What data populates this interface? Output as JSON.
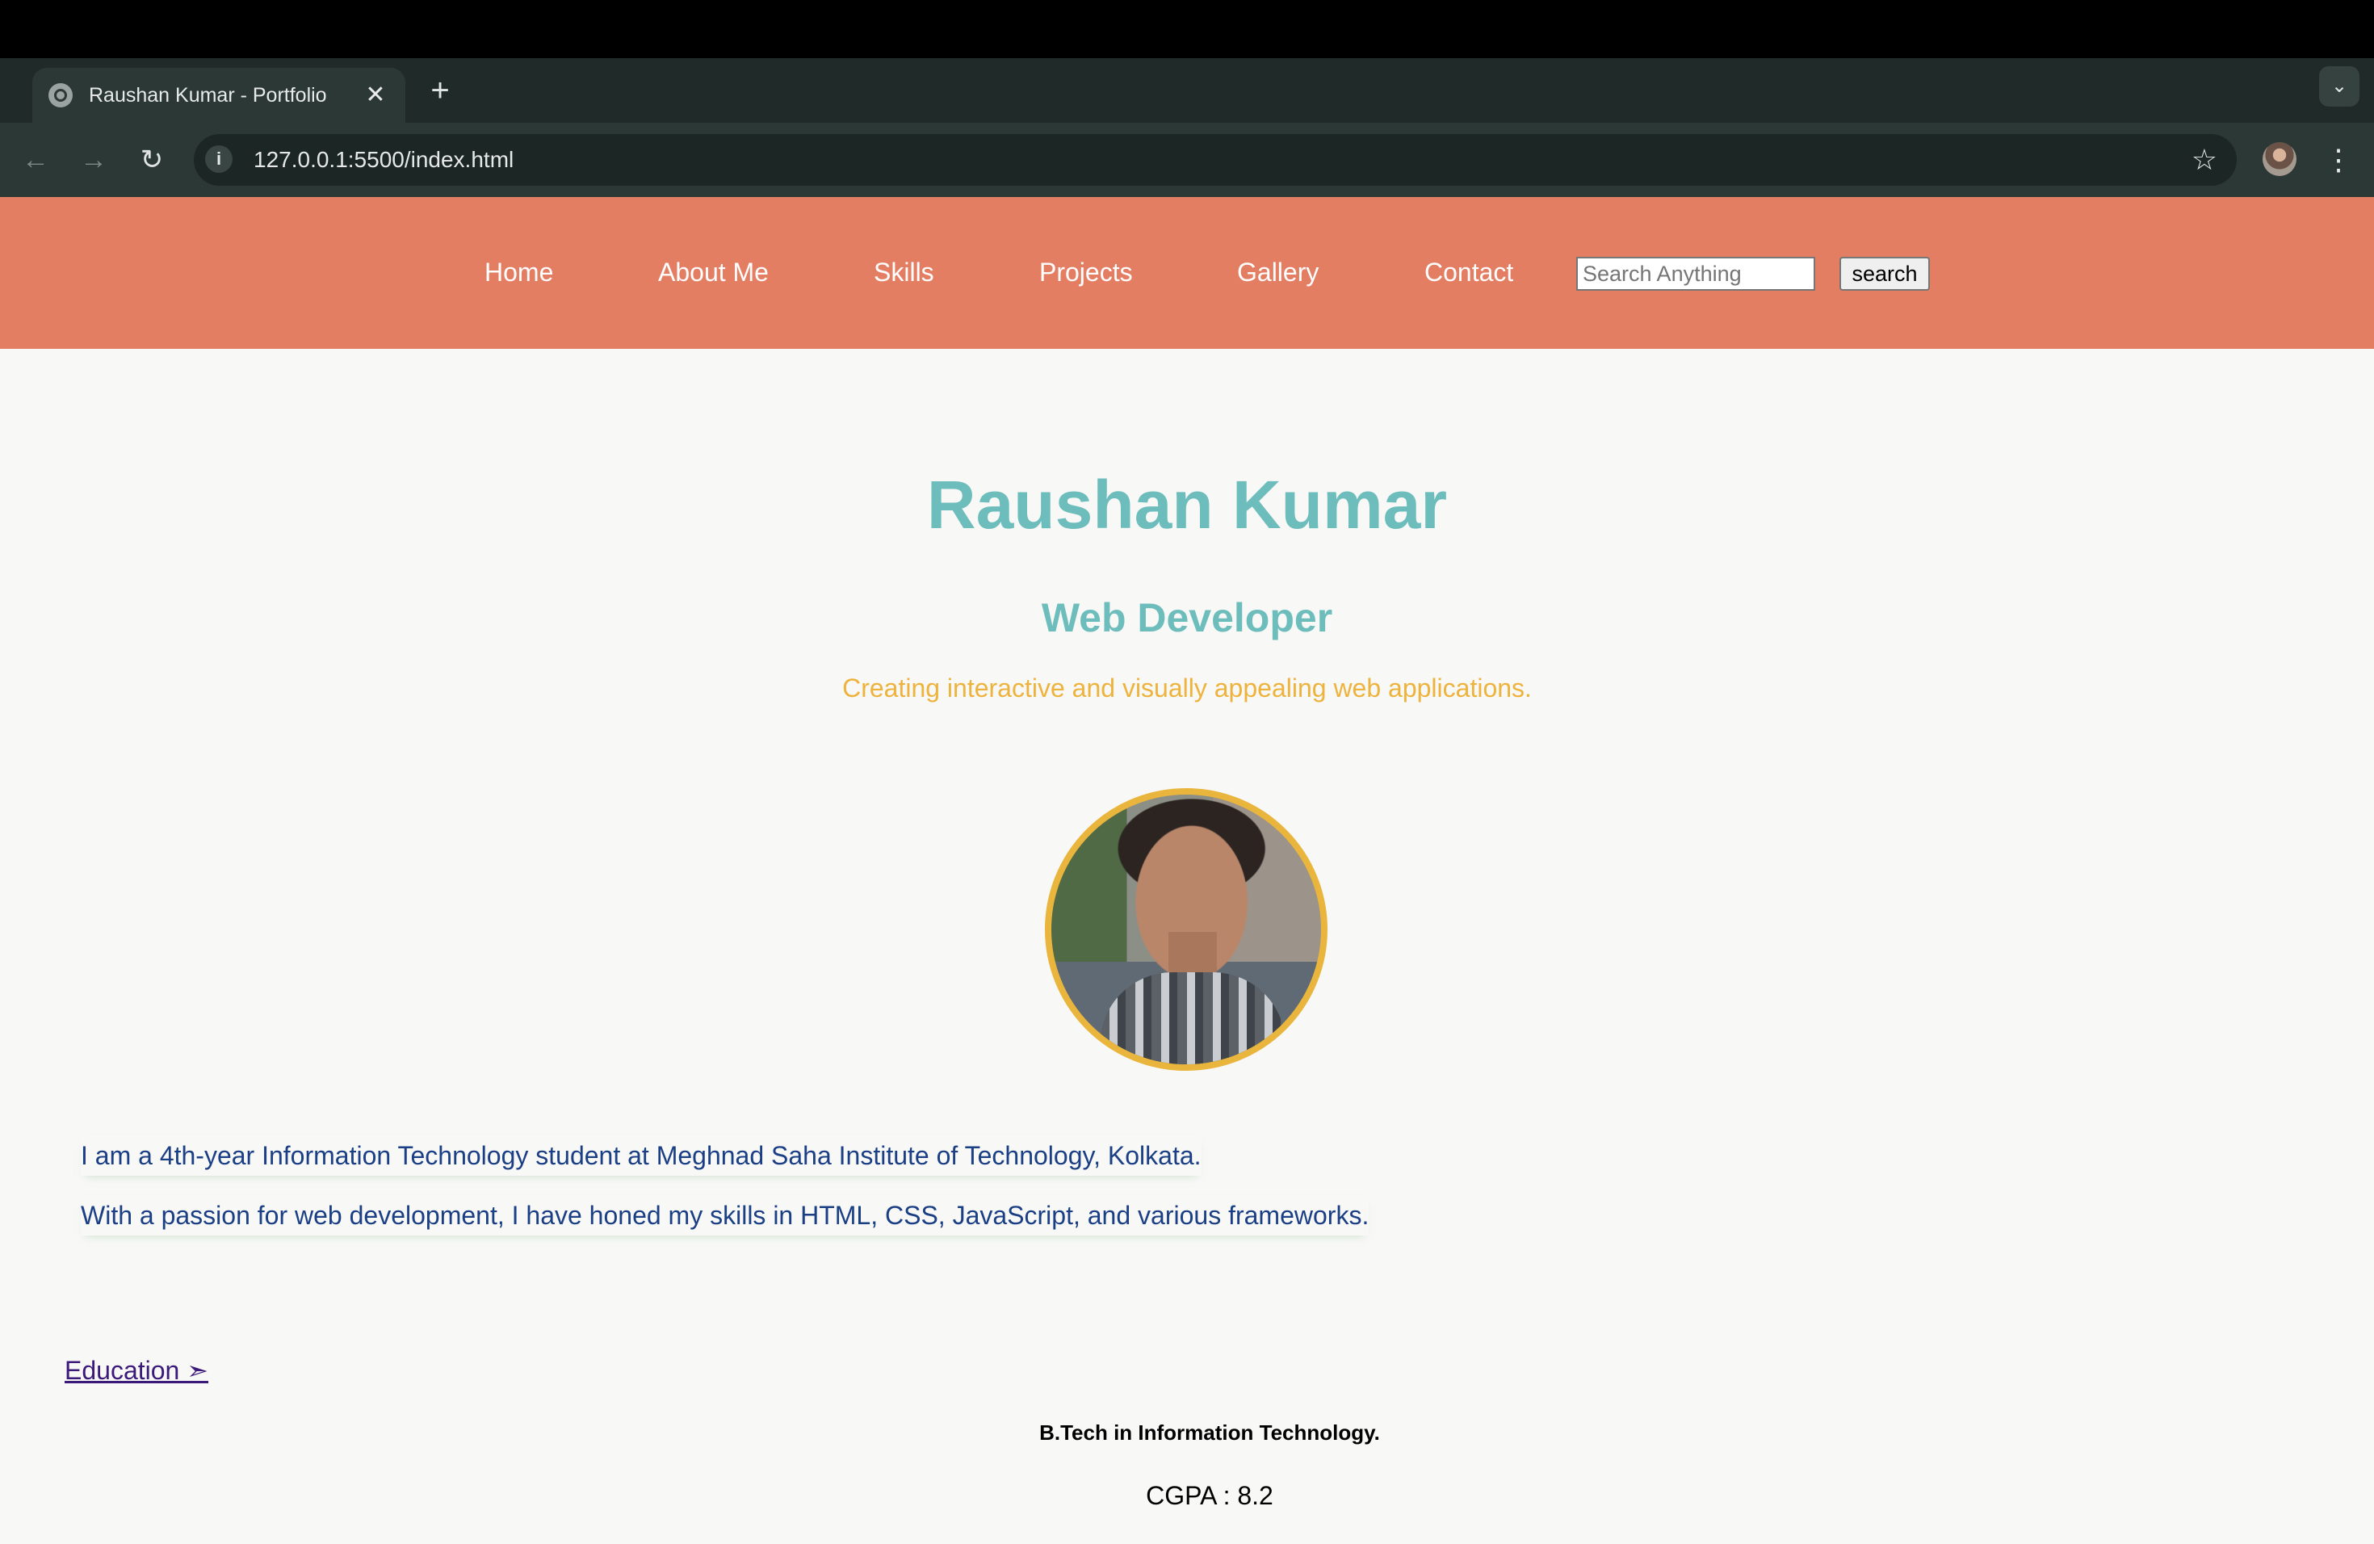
{
  "browser": {
    "tab_title": "Raushan Kumar - Portfolio",
    "tab_close": "✕",
    "new_tab": "+",
    "tab_menu": "⌄",
    "back": "←",
    "forward": "→",
    "reload": "↻",
    "info": "i",
    "url": "127.0.0.1:5500/index.html",
    "bookmark_star": "☆",
    "menu": "⋮"
  },
  "nav": {
    "links": [
      "Home",
      "About Me",
      "Skills",
      "Projects",
      "Gallery",
      "Contact"
    ],
    "search_placeholder": "Search Anything",
    "search_button": "search"
  },
  "hero": {
    "name": "Raushan Kumar",
    "role": "Web Developer",
    "tagline": "Creating interactive and visually appealing web applications."
  },
  "about": {
    "line1": "I am a 4th-year Information Technology student at Meghnad Saha Institute of Technology, Kolkata.",
    "line2": "With a passion for web development, I have honed my skills in HTML, CSS, JavaScript, and various frameworks."
  },
  "education": {
    "toggle_label": "Education ➣",
    "degree": "B.Tech in Information Technology.",
    "cgpa": "CGPA : 8.2"
  },
  "colors": {
    "nav_bg": "#e37e63",
    "heading": "#6cbdbb",
    "tagline": "#edb33c",
    "photo_border": "#e9b53c",
    "about_text": "#1b3f85"
  }
}
